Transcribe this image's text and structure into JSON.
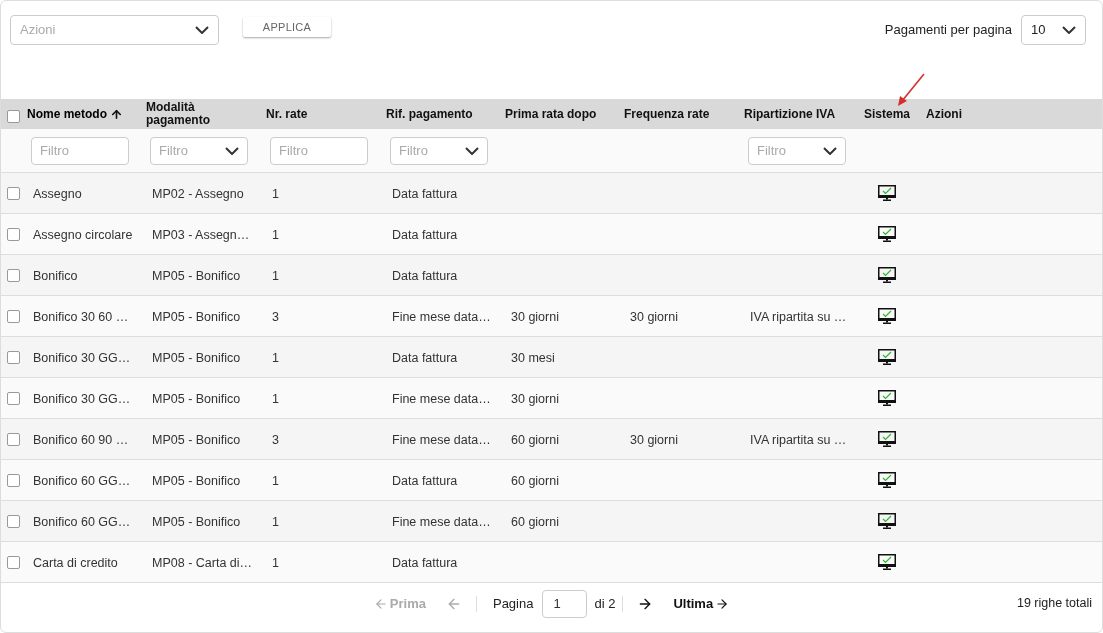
{
  "toolbar": {
    "actions_select": {
      "placeholder": "Azioni"
    },
    "apply_button": "APPLICA",
    "page_size_label": "Pagamenti per pagina",
    "page_size_select": {
      "value": "10"
    }
  },
  "annotation": {
    "kind": "arrow"
  },
  "table": {
    "select_all_checked": false,
    "columns": [
      {
        "label": "Nome metodo",
        "sorted": true,
        "filter": {
          "kind": "text",
          "placeholder": "Filtro"
        }
      },
      {
        "label": "Modalità pagamento",
        "sorted": false,
        "filter": {
          "kind": "select",
          "placeholder": "Filtro"
        }
      },
      {
        "label": "Nr. rate",
        "sorted": false,
        "filter": {
          "kind": "text",
          "placeholder": "Filtro"
        }
      },
      {
        "label": "Rif. pagamento",
        "sorted": false,
        "filter": {
          "kind": "select",
          "placeholder": "Filtro"
        }
      },
      {
        "label": "Prima rata dopo",
        "sorted": false
      },
      {
        "label": "Frequenza rate",
        "sorted": false
      },
      {
        "label": "Ripartizione IVA",
        "sorted": false,
        "filter": {
          "kind": "select",
          "placeholder": "Filtro"
        }
      },
      {
        "label": "Sistema",
        "sorted": false
      },
      {
        "label": "Azioni",
        "sorted": false
      }
    ],
    "rows": [
      {
        "checked": false,
        "system": true,
        "cells": [
          "Assegno",
          "MP02 - Assegno",
          "1",
          "Data fattura",
          "",
          "",
          ""
        ]
      },
      {
        "checked": false,
        "system": true,
        "cells": [
          "Assegno circolare",
          "MP03 - Assegn…",
          "1",
          "Data fattura",
          "",
          "",
          ""
        ]
      },
      {
        "checked": false,
        "system": true,
        "cells": [
          "Bonifico",
          "MP05 - Bonifico",
          "1",
          "Data fattura",
          "",
          "",
          ""
        ]
      },
      {
        "checked": false,
        "system": true,
        "cells": [
          "Bonifico 30 60 …",
          "MP05 - Bonifico",
          "3",
          "Fine mese data…",
          "30 giorni",
          "30 giorni",
          "IVA ripartita su …"
        ]
      },
      {
        "checked": false,
        "system": true,
        "cells": [
          "Bonifico 30 GG…",
          "MP05 - Bonifico",
          "1",
          "Data fattura",
          "30 mesi",
          "",
          ""
        ]
      },
      {
        "checked": false,
        "system": true,
        "cells": [
          "Bonifico 30 GG…",
          "MP05 - Bonifico",
          "1",
          "Fine mese data…",
          "30 giorni",
          "",
          ""
        ]
      },
      {
        "checked": false,
        "system": true,
        "cells": [
          "Bonifico 60 90 …",
          "MP05 - Bonifico",
          "3",
          "Fine mese data…",
          "60 giorni",
          "30 giorni",
          "IVA ripartita su …"
        ]
      },
      {
        "checked": false,
        "system": true,
        "cells": [
          "Bonifico 60 GG…",
          "MP05 - Bonifico",
          "1",
          "Data fattura",
          "60 giorni",
          "",
          ""
        ]
      },
      {
        "checked": false,
        "system": true,
        "cells": [
          "Bonifico 60 GG…",
          "MP05 - Bonifico",
          "1",
          "Fine mese data…",
          "60 giorni",
          "",
          ""
        ]
      },
      {
        "checked": false,
        "system": true,
        "cells": [
          "Carta di credito",
          "MP08 - Carta di…",
          "1",
          "Data fattura",
          "",
          "",
          ""
        ]
      }
    ]
  },
  "pagination": {
    "first": {
      "label": "Prima",
      "disabled": true
    },
    "prev": {
      "disabled": true
    },
    "page_label": "Pagina",
    "page_value": "1",
    "of_label": "di 2",
    "next": {
      "disabled": false
    },
    "last": {
      "label": "Ultima",
      "disabled": false
    },
    "total": "19 righe totali"
  }
}
